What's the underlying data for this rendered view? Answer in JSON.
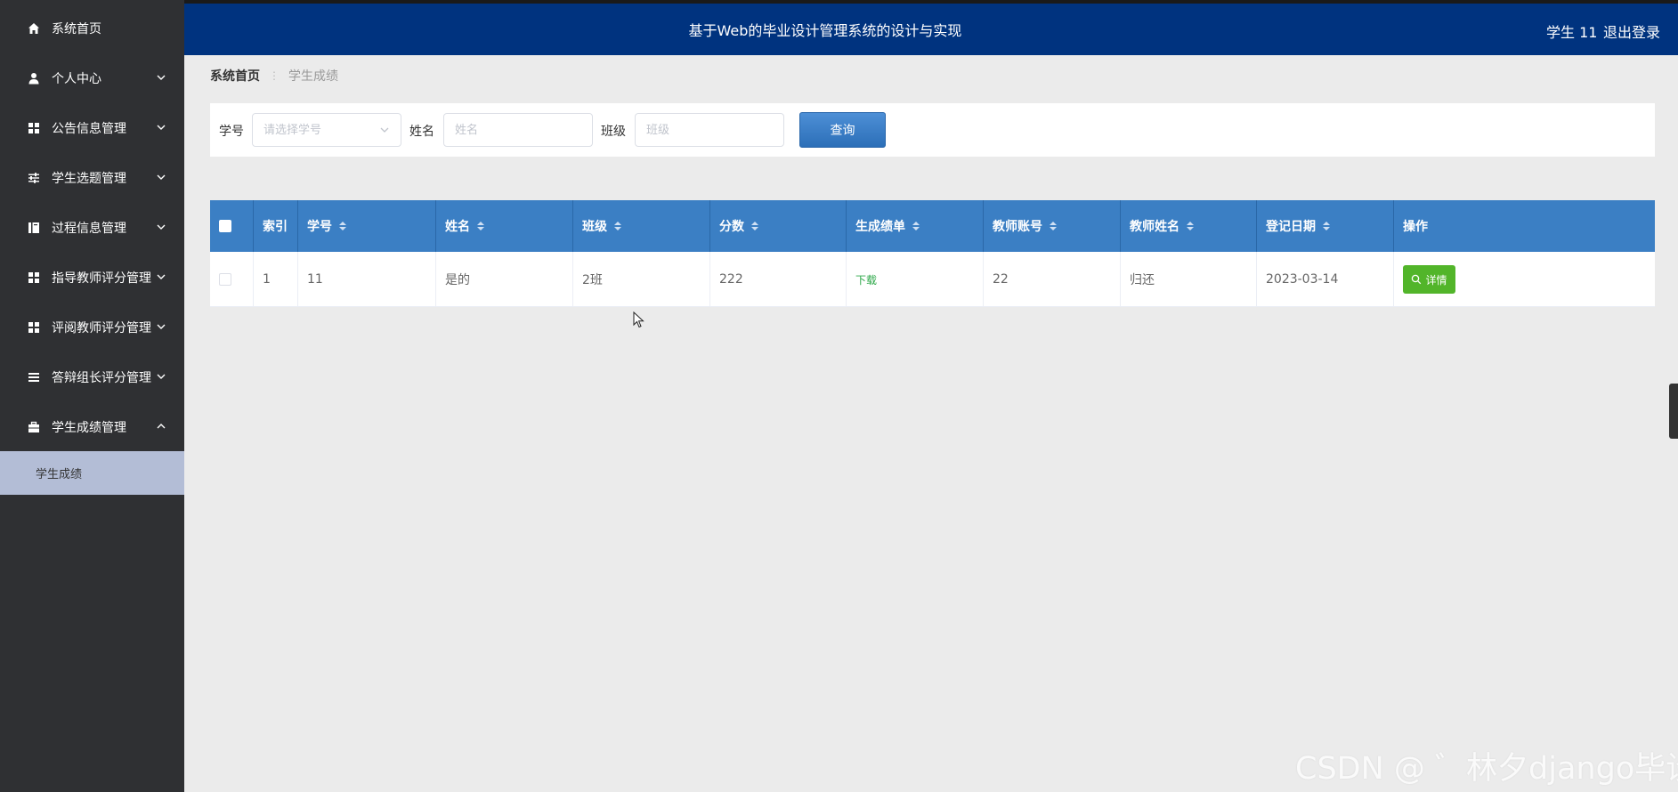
{
  "app": {
    "title": "基于Web的毕业设计管理系统的设计与实现",
    "user": "学生 11",
    "logout": "退出登录"
  },
  "sidebar": {
    "items": [
      {
        "label": "系统首页",
        "icon": "home-icon"
      },
      {
        "label": "个人中心",
        "icon": "user-icon"
      },
      {
        "label": "公告信息管理",
        "icon": "grid-icon"
      },
      {
        "label": "学生选题管理",
        "icon": "sliders-icon"
      },
      {
        "label": "过程信息管理",
        "icon": "book-icon"
      },
      {
        "label": "指导教师评分管理",
        "icon": "grid-icon"
      },
      {
        "label": "评阅教师评分管理",
        "icon": "grid-icon"
      },
      {
        "label": "答辩组长评分管理",
        "icon": "list-icon"
      },
      {
        "label": "学生成绩管理",
        "icon": "briefcase-icon"
      }
    ],
    "sub_item": "学生成绩"
  },
  "breadcrumb": {
    "home": "系统首页",
    "current": "学生成绩"
  },
  "search": {
    "xuehao_label": "学号",
    "xuehao_placeholder": "请选择学号",
    "xingming_label": "姓名",
    "xingming_placeholder": "姓名",
    "banji_label": "班级",
    "banji_placeholder": "班级",
    "query_button": "查询"
  },
  "table": {
    "headers": [
      "索引",
      "学号",
      "姓名",
      "班级",
      "分数",
      "生成绩单",
      "教师账号",
      "教师姓名",
      "登记日期",
      "操作"
    ],
    "rows": [
      {
        "index": "1",
        "xuehao": "11",
        "xingming": "是的",
        "banji": "2班",
        "fenshu": "222",
        "chengjidan": "下载",
        "jiaoshi_zhanghao": "22",
        "jiaoshi_xingming": "归还",
        "riqi": "2023-03-14",
        "action": "详情"
      }
    ]
  },
  "watermark": "CSDN @ ゛林夕django毕设",
  "colors": {
    "sidebar": "#2f3033",
    "header": "#00337f",
    "table_header": "#3b7fc4",
    "query_button": "#3a7fc6",
    "detail_button": "#52b52a",
    "submenu_active": "#b3bdd6"
  }
}
